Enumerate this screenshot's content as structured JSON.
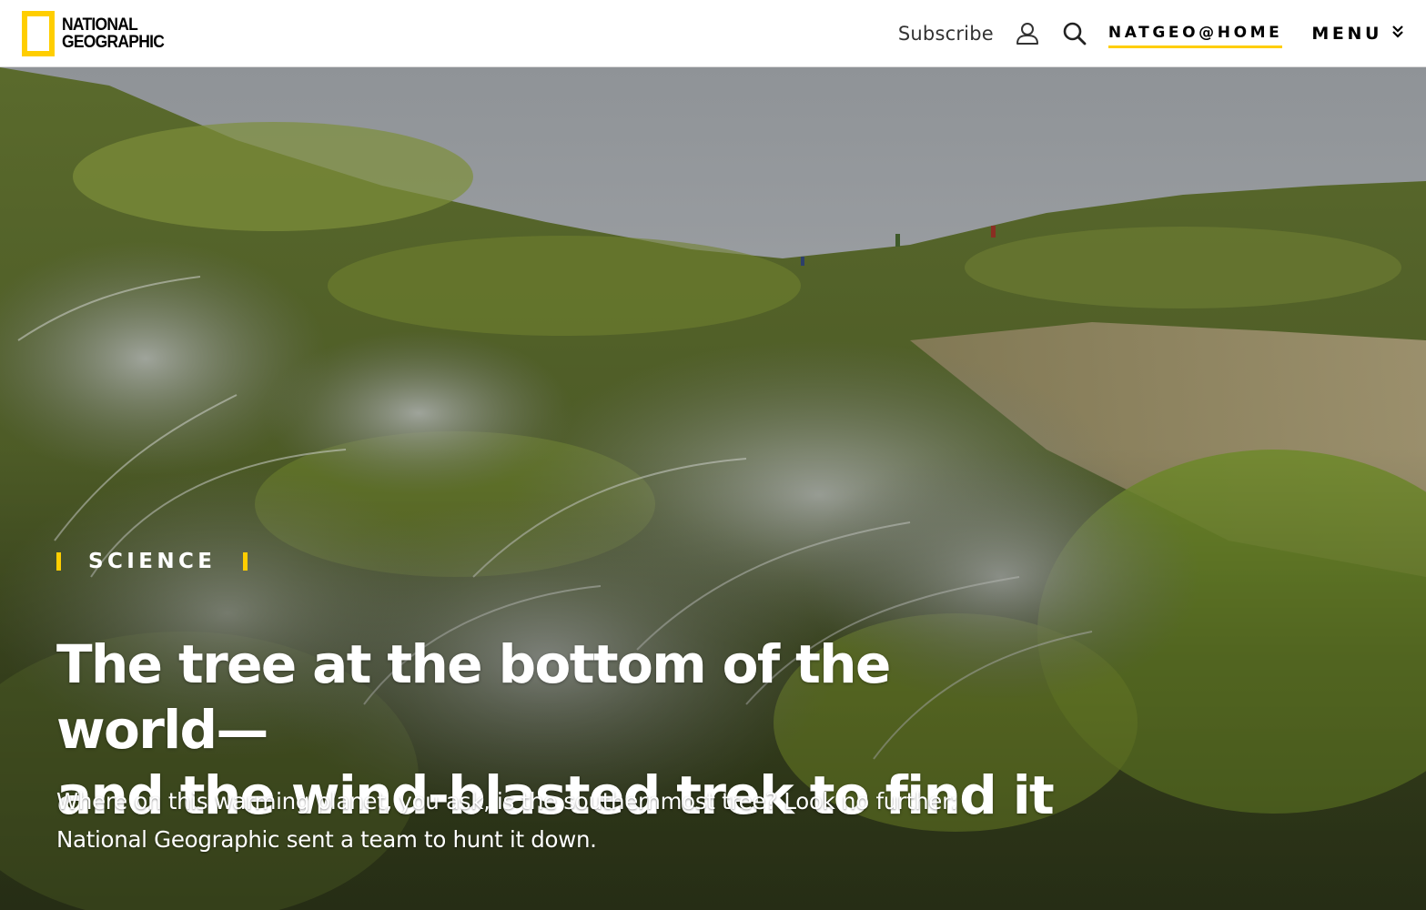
{
  "header": {
    "logo_lines": [
      "NATIONAL",
      "GEOGRAPHIC"
    ],
    "subscribe_label": "Subscribe",
    "natgeo_home_label": "NATGEO@HOME",
    "menu_label": "MENU",
    "icons": [
      "user-icon",
      "search-icon",
      "chevron-double-down-icon"
    ],
    "accent_color": "#FFCE00"
  },
  "hero": {
    "kicker": "SCIENCE",
    "headline_lines": [
      "The tree at the bottom of the world—",
      "and the wind-blasted trek to find it"
    ],
    "dek_lines": [
      "Where on this warming planet, you ask, is the southernmost tree? Look no further:",
      "National Geographic sent a team to hunt it down."
    ]
  }
}
